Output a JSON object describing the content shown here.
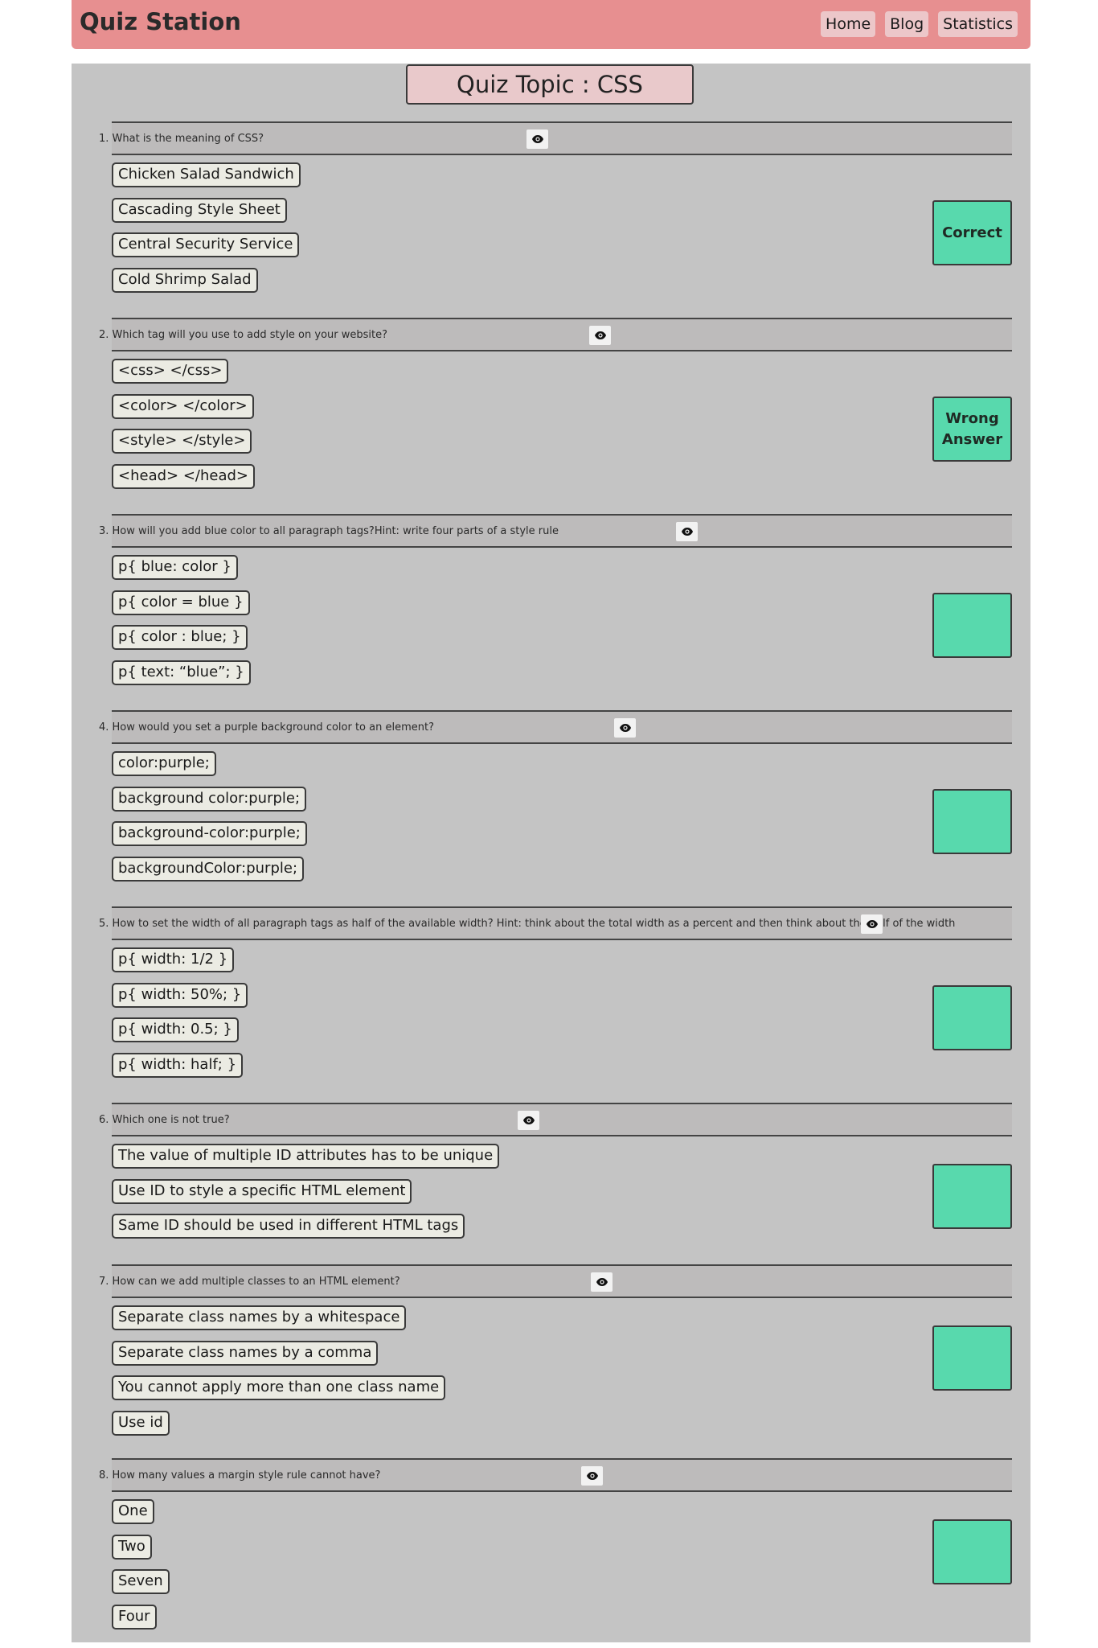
{
  "brand": "Quiz Station",
  "nav": [
    "Home",
    "Blog",
    "Statistics"
  ],
  "topic": "Quiz Topic : CSS",
  "questions": [
    {
      "text": "1. What is the meaning of CSS?",
      "options": [
        "Chicken Salad Sandwich",
        "Cascading Style Sheet",
        "Central Security Service",
        "Cold Shrimp Salad"
      ],
      "result": "Correct"
    },
    {
      "text": "2. Which tag will you use to add style on your website?",
      "options": [
        "<css> </css>",
        "<color> </color>",
        "<style> </style>",
        "<head> </head>"
      ],
      "result": "Wrong Answer"
    },
    {
      "text": "3. How will you add blue color to all paragraph tags?Hint: write four parts of a style rule",
      "options": [
        "p{ blue: color }",
        "p{ color = blue }",
        "p{ color : blue; }",
        "p{ text: “blue”; }"
      ],
      "result": ""
    },
    {
      "text": "4. How would you set a purple background color to an element?",
      "options": [
        "color:purple;",
        "background color:purple;",
        "background-color:purple;",
        "backgroundColor:purple;"
      ],
      "result": ""
    },
    {
      "text": "5. How to set the width of all paragraph tags as half of the available width? Hint: think about the total width as a percent and then think about the half of the width",
      "options": [
        "p{ width: 1/2 }",
        "p{ width: 50%; }",
        "p{ width: 0.5; }",
        "p{ width: half; }"
      ],
      "result": ""
    },
    {
      "text": "6. Which one is not true?",
      "options": [
        "The value of multiple ID attributes has to be unique",
        "Use ID to style a specific HTML element",
        "Same ID should be used in different HTML tags"
      ],
      "result": ""
    },
    {
      "text": "7. How can we add multiple classes to an HTML element?",
      "options": [
        "Separate class names by a whitespace",
        "Separate class names by a comma",
        "You cannot apply more than one class name",
        "Use id"
      ],
      "result": ""
    },
    {
      "text": "8. How many values a margin style rule cannot have?",
      "options": [
        "One",
        "Two",
        "Seven",
        "Four"
      ],
      "result": ""
    }
  ],
  "icons": {
    "reveal": "eye-icon"
  },
  "colors": {
    "navbar": "#e78f90",
    "result": "#58d9ad",
    "panel": "#c4c4c4"
  }
}
